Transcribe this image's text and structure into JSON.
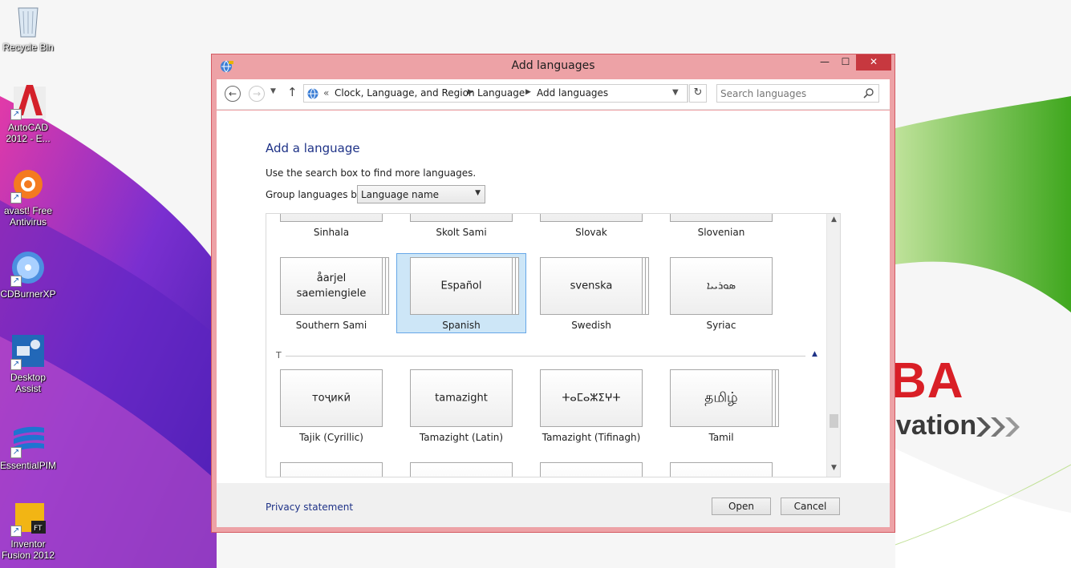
{
  "desktop": {
    "icons": [
      {
        "label": "Recycle Bin",
        "icon": "recycle-bin-icon"
      },
      {
        "label": "AutoCAD 2012 - E...",
        "icon": "autocad-icon"
      },
      {
        "label": "avast! Free Antivirus",
        "icon": "avast-icon"
      },
      {
        "label": "CDBurnerXP",
        "icon": "cdburnerxp-icon"
      },
      {
        "label": "Desktop Assist",
        "icon": "desktop-assist-icon"
      },
      {
        "label": "EssentialPIM",
        "icon": "essentialpim-icon"
      },
      {
        "label": "Inventor Fusion 2012",
        "icon": "inventor-fusion-icon"
      }
    ],
    "wallpaper_text": {
      "brand": "BA",
      "tagline": "vation"
    },
    "colors": {
      "brand_red": "#d91f26",
      "purple": "#7a2fd0",
      "green": "#5cb82e"
    }
  },
  "window": {
    "title": "Add languages",
    "controls": {
      "minimize": "—",
      "maximize": "☐",
      "close": "✕"
    },
    "titlebar_color": "#eda2a6",
    "navigation": {
      "breadcrumbs": [
        "Clock, Language, and Region",
        "Language",
        "Add languages"
      ],
      "overflow": "«",
      "search_placeholder": "Search languages"
    },
    "content": {
      "heading": "Add a language",
      "instruction": "Use the search box to find more languages.",
      "group_by_label": "Group languages by:",
      "group_by_value": "Language name",
      "rows": [
        {
          "tiles": [
            {
              "label": "Sinhala",
              "native": ""
            },
            {
              "label": "Skolt Sami",
              "native": ""
            },
            {
              "label": "Slovak",
              "native": ""
            },
            {
              "label": "Slovenian",
              "native": ""
            }
          ]
        },
        {
          "tiles": [
            {
              "label": "Southern Sami",
              "native": "åarjel saemiengiele",
              "stacked": true
            },
            {
              "label": "Spanish",
              "native": "Español",
              "stacked": true,
              "selected": true
            },
            {
              "label": "Swedish",
              "native": "svenska",
              "stacked": true
            },
            {
              "label": "Syriac",
              "native": "ܣܘܪܝܝܐ",
              "stacked": false
            }
          ]
        },
        {
          "section": "T"
        },
        {
          "tiles": [
            {
              "label": "Tajik (Cyrillic)",
              "native": "тоҷикӣ",
              "stacked": false
            },
            {
              "label": "Tamazight (Latin)",
              "native": "tamazight",
              "stacked": false
            },
            {
              "label": "Tamazight (Tifinagh)",
              "native": "ⵜⴰⵎⴰⵣⵉⵖⵜ",
              "stacked": false
            },
            {
              "label": "Tamil",
              "native": "தமிழ்",
              "stacked": true
            }
          ]
        }
      ],
      "selection_color": "#cde6f7",
      "heading_color": "#1e3287"
    },
    "footer": {
      "privacy_link": "Privacy statement",
      "open_button": "Open",
      "cancel_button": "Cancel"
    }
  }
}
